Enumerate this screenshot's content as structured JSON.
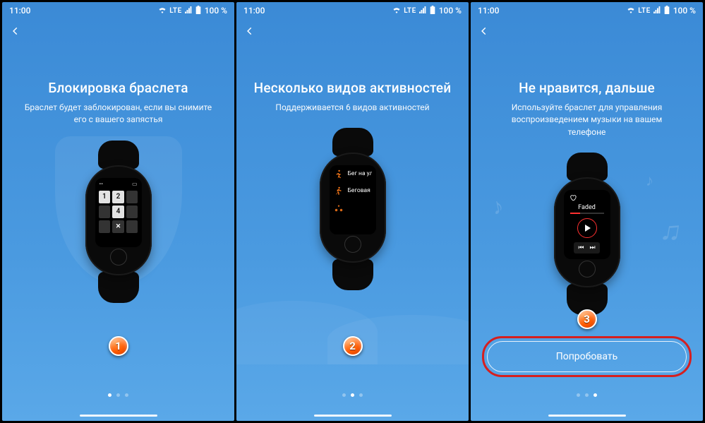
{
  "status": {
    "time": "11:00",
    "network": "LTE",
    "battery": "100 %"
  },
  "screens": [
    {
      "title": "Блокировка браслета",
      "subtitle": "Браслет будет заблокирован, если вы снимите его с вашего запястья",
      "marker": "1",
      "keypad": {
        "k1": "1",
        "k2": "2",
        "k4": "4",
        "kx": "✕"
      }
    },
    {
      "title": "Несколько видов активностей",
      "subtitle": "Поддерживается 6 видов активностей",
      "marker": "2",
      "activities": {
        "a1": "Бег на ули",
        "a2": "Беговая дс"
      }
    },
    {
      "title": "Не нравится, дальше",
      "subtitle": "Используйте браслет для управления воспроизведением музыки на вашем телефоне",
      "marker": "3",
      "music": {
        "track": "Faded",
        "prev": "⏮",
        "next": "⏭"
      },
      "cta": "Попробовать"
    }
  ]
}
